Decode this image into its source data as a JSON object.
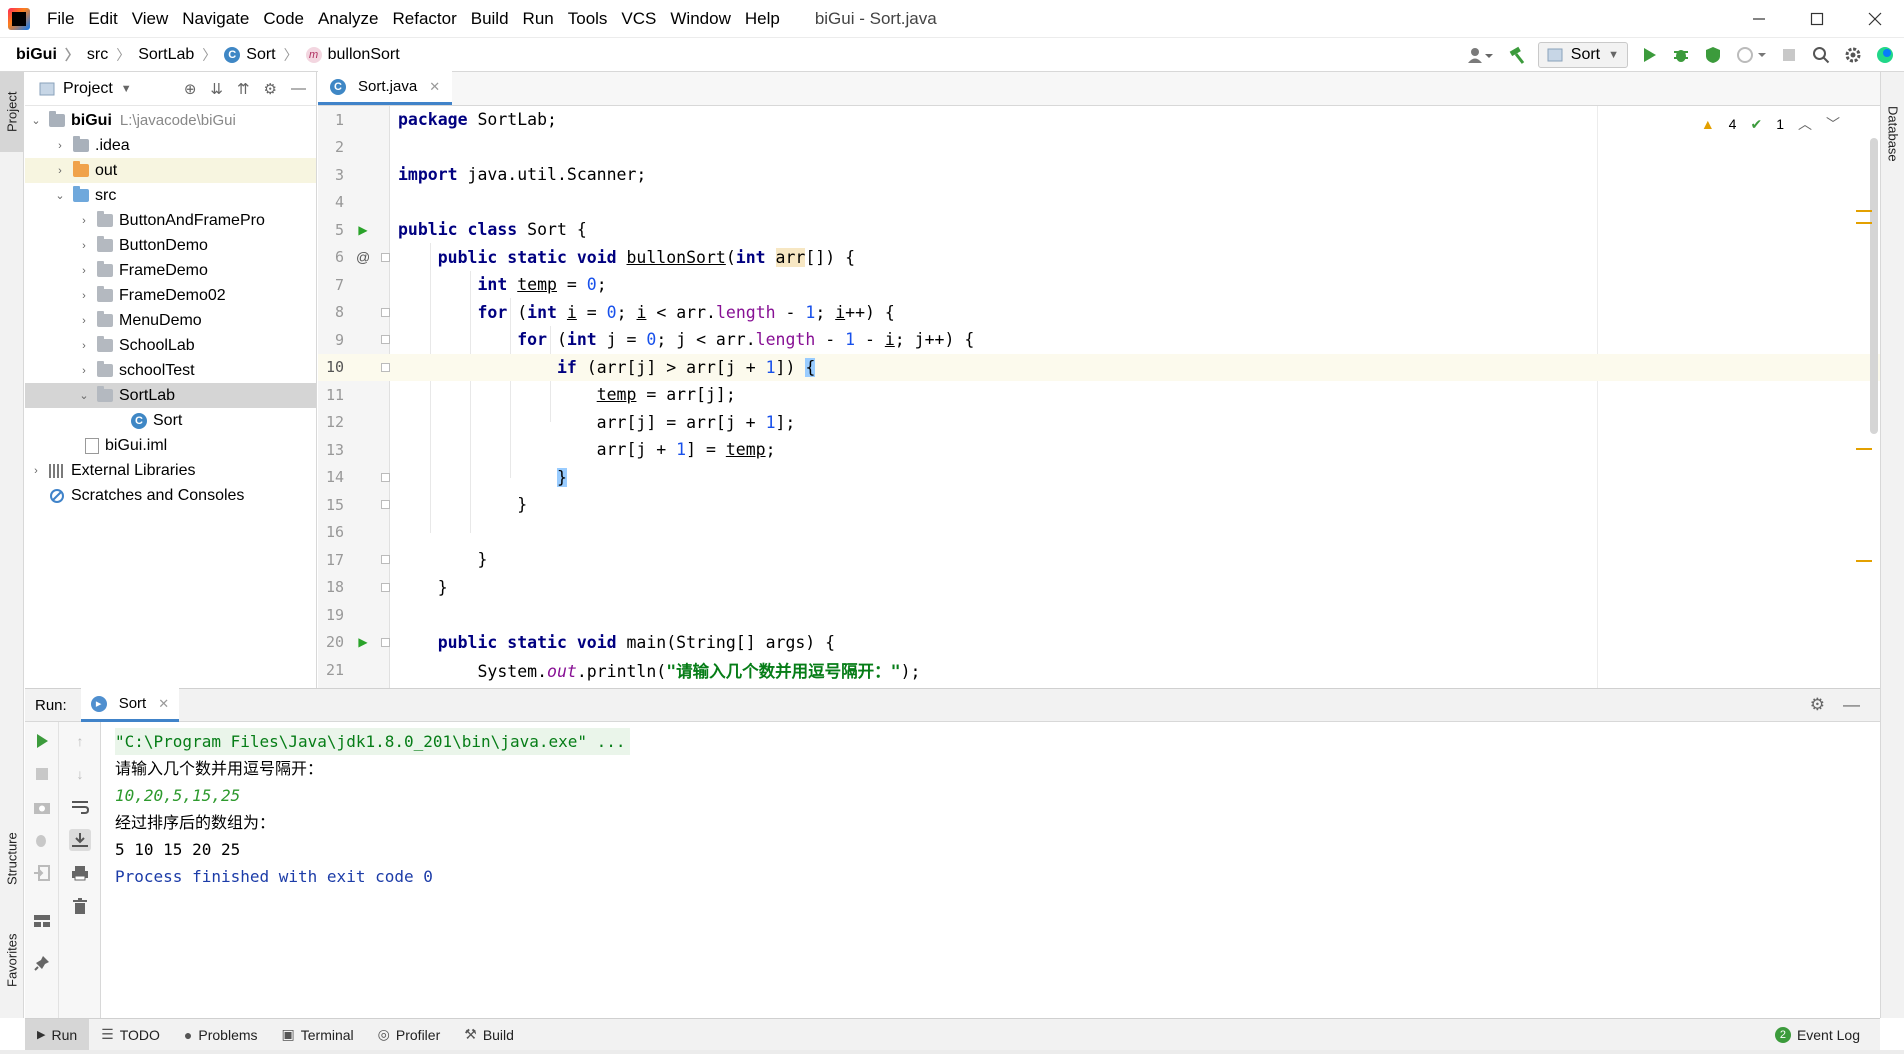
{
  "window": {
    "title": "biGui - Sort.java",
    "menu": [
      "File",
      "Edit",
      "View",
      "Navigate",
      "Code",
      "Analyze",
      "Refactor",
      "Build",
      "Run",
      "Tools",
      "VCS",
      "Window",
      "Help"
    ]
  },
  "breadcrumb": {
    "items": [
      "biGui",
      "src",
      "SortLab",
      "Sort",
      "bullonSort"
    ]
  },
  "toolbar": {
    "run_config": "Sort"
  },
  "tool_stripes": {
    "left": [
      "Project",
      "Structure",
      "Favorites"
    ],
    "right": [
      "Database"
    ]
  },
  "project_panel": {
    "title": "Project",
    "root_name": "biGui",
    "root_path": "L:\\javacode\\biGui",
    "items": {
      "idea": ".idea",
      "out": "out",
      "src": "src",
      "p1": "ButtonAndFramePro",
      "p2": "ButtonDemo",
      "p3": "FrameDemo",
      "p4": "FrameDemo02",
      "p5": "MenuDemo",
      "p6": "SchoolLab",
      "p7": "schoolTest",
      "p8": "SortLab",
      "sort": "Sort",
      "iml": "biGui.iml",
      "ext": "External Libraries",
      "scratch": "Scratches and Consoles"
    }
  },
  "editor": {
    "tab": "Sort.java",
    "warnings": "4",
    "checks": "1",
    "line_numbers": [
      "1",
      "2",
      "3",
      "4",
      "5",
      "6",
      "7",
      "8",
      "9",
      "10",
      "11",
      "12",
      "13",
      "14",
      "15",
      "16",
      "17",
      "18",
      "19",
      "20",
      "21"
    ],
    "current_line": 10
  },
  "run_panel": {
    "label": "Run:",
    "tab": "Sort",
    "console": {
      "cmd": "\"C:\\Program Files\\Java\\jdk1.8.0_201\\bin\\java.exe\" ...",
      "prompt": "请输入几个数并用逗号隔开：",
      "input": "10,20,5,15,25",
      "result_label": "经过排序后的数组为：",
      "result": "5 10 15 20 25",
      "exit": "Process finished with exit code 0"
    }
  },
  "bottom_bar": {
    "run": "Run",
    "todo": "TODO",
    "problems": "Problems",
    "terminal": "Terminal",
    "profiler": "Profiler",
    "build": "Build",
    "event_log": "Event Log",
    "event_count": "2"
  },
  "colors": {
    "accent": "#4083c9",
    "keyword": "#000080",
    "number": "#1750eb",
    "string": "#067d17",
    "warning": "#e3a000"
  }
}
